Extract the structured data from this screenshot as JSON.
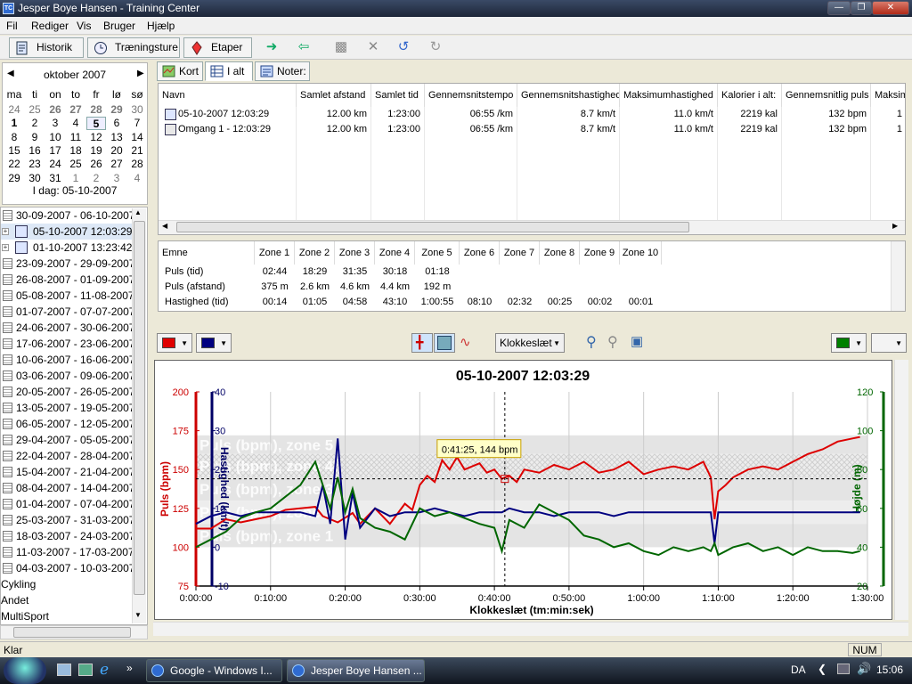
{
  "window": {
    "title": "Jesper Boye Hansen - Training Center",
    "app_icon_text": "TC"
  },
  "menu": [
    "Fil",
    "Rediger",
    "Vis",
    "Bruger",
    "Hjælp"
  ],
  "toolbar": {
    "historik": "Historik",
    "traeningsture": "Træningsture",
    "etaper": "Etaper"
  },
  "calendar": {
    "month": "oktober 2007",
    "weekdays": [
      "ma",
      "ti",
      "on",
      "to",
      "fr",
      "lø",
      "sø"
    ],
    "weeks": [
      [
        "24",
        "25",
        "26",
        "27",
        "28",
        "29",
        "30"
      ],
      [
        "1",
        "2",
        "3",
        "4",
        "5",
        "6",
        "7"
      ],
      [
        "8",
        "9",
        "10",
        "11",
        "12",
        "13",
        "14"
      ],
      [
        "15",
        "16",
        "17",
        "18",
        "19",
        "20",
        "21"
      ],
      [
        "22",
        "23",
        "24",
        "25",
        "26",
        "27",
        "28"
      ],
      [
        "29",
        "30",
        "31",
        "1",
        "2",
        "3",
        "4"
      ]
    ],
    "today": "I dag: 05-10-2007"
  },
  "tree": [
    {
      "label": "30-09-2007 - 06-10-2007",
      "type": "week"
    },
    {
      "label": "05-10-2007 12:03:29",
      "type": "activity",
      "selected": true
    },
    {
      "label": "01-10-2007 13:23:42",
      "type": "activity"
    },
    {
      "label": "23-09-2007 - 29-09-2007",
      "type": "week"
    },
    {
      "label": "26-08-2007 - 01-09-2007",
      "type": "week"
    },
    {
      "label": "05-08-2007 - 11-08-2007",
      "type": "week"
    },
    {
      "label": "01-07-2007 - 07-07-2007",
      "type": "week"
    },
    {
      "label": "24-06-2007 - 30-06-2007",
      "type": "week"
    },
    {
      "label": "17-06-2007 - 23-06-2007",
      "type": "week"
    },
    {
      "label": "10-06-2007 - 16-06-2007",
      "type": "week"
    },
    {
      "label": "03-06-2007 - 09-06-2007",
      "type": "week"
    },
    {
      "label": "20-05-2007 - 26-05-2007",
      "type": "week"
    },
    {
      "label": "13-05-2007 - 19-05-2007",
      "type": "week"
    },
    {
      "label": "06-05-2007 - 12-05-2007",
      "type": "week"
    },
    {
      "label": "29-04-2007 - 05-05-2007",
      "type": "week"
    },
    {
      "label": "22-04-2007 - 28-04-2007",
      "type": "week"
    },
    {
      "label": "15-04-2007 - 21-04-2007",
      "type": "week"
    },
    {
      "label": "08-04-2007 - 14-04-2007",
      "type": "week"
    },
    {
      "label": "01-04-2007 - 07-04-2007",
      "type": "week"
    },
    {
      "label": "25-03-2007 - 31-03-2007",
      "type": "week"
    },
    {
      "label": "18-03-2007 - 24-03-2007",
      "type": "week"
    },
    {
      "label": "11-03-2007 - 17-03-2007",
      "type": "week"
    },
    {
      "label": "04-03-2007 - 10-03-2007",
      "type": "week"
    },
    {
      "label": "Cykling",
      "type": "category"
    },
    {
      "label": "Andet",
      "type": "category"
    },
    {
      "label": "MultiSport",
      "type": "category"
    }
  ],
  "tabs": [
    "Kort",
    "I alt",
    "Noter:"
  ],
  "summary": {
    "columns": [
      "Navn",
      "Samlet afstand",
      "Samlet tid",
      "Gennemsnitstempo",
      "Gennemsnitshastighed",
      "Maksimumhastighed",
      "Kalorier i alt:",
      "Gennemsnitlig puls",
      "Maksim"
    ],
    "rows": [
      [
        "05-10-2007 12:03:29",
        "12.00 km",
        "1:23:00",
        "06:55 /km",
        "8.7 km/t",
        "11.0 km/t",
        "2219 kal",
        "132 bpm",
        "1"
      ],
      [
        "Omgang 1 - 12:03:29",
        "12.00 km",
        "1:23:00",
        "06:55 /km",
        "8.7 km/t",
        "11.0 km/t",
        "2219 kal",
        "132 bpm",
        "1"
      ]
    ]
  },
  "zones": {
    "columns": [
      "Emne",
      "Zone 1",
      "Zone 2",
      "Zone 3",
      "Zone 4",
      "Zone 5",
      "Zone 6",
      "Zone 7",
      "Zone 8",
      "Zone 9",
      "Zone 10"
    ],
    "rows": [
      [
        "Puls (tid)",
        "02:44",
        "18:29",
        "31:35",
        "30:18",
        "01:18",
        "",
        "",
        "",
        "",
        ""
      ],
      [
        "Puls (afstand)",
        "375 m",
        "2.6 km",
        "4.6 km",
        "4.4 km",
        "192 m",
        "",
        "",
        "",
        "",
        ""
      ],
      [
        "Hastighed (tid)",
        "00:14",
        "01:05",
        "04:58",
        "43:10",
        "1:00:55",
        "08:10",
        "02:32",
        "00:25",
        "00:02",
        "00:01"
      ]
    ]
  },
  "graph_toolbar": {
    "time_mode": "Klokkeslæt",
    "color_left1": "#e00000",
    "color_left2": "#000080",
    "color_right": "#008000"
  },
  "chart_data": {
    "type": "line",
    "title": "05-10-2007 12:03:29",
    "xlabel": "Klokkeslæt (tm:min:sek)",
    "x_ticks": [
      "0:00:00",
      "0:10:00",
      "0:20:00",
      "0:30:00",
      "0:40:00",
      "0:50:00",
      "1:00:00",
      "1:10:00",
      "1:20:00",
      "1:30:00"
    ],
    "xlim": [
      0,
      90
    ],
    "axes": [
      {
        "label": "Puls (bpm)",
        "color": "#cc0000",
        "ticks": [
          "75",
          "100",
          "125",
          "150",
          "175",
          "200"
        ],
        "lim": [
          75,
          200
        ]
      },
      {
        "label": "Hastighed (km/t)",
        "color": "#000066",
        "ticks": [
          "-10",
          "0",
          "10",
          "20",
          "30",
          "40"
        ],
        "lim": [
          -10,
          40
        ]
      },
      {
        "label": "Højde (m)",
        "color": "#006600",
        "ticks": [
          "20",
          "40",
          "60",
          "80",
          "100",
          "120"
        ],
        "lim": [
          20,
          120
        ]
      }
    ],
    "zone_labels": [
      "Puls (bpm), zone 5",
      "Puls (bpm), zone 4",
      "Puls (bpm), zone 3",
      "Puls (bpm), zone 2",
      "Puls (bpm), zone 1"
    ],
    "zone_bands_bpm": [
      [
        160,
        172
      ],
      [
        145,
        160
      ],
      [
        130,
        145
      ],
      [
        115,
        130
      ],
      [
        100,
        115
      ]
    ],
    "tooltip": "0:41:25, 144 bpm",
    "cursor": {
      "x": 41.4,
      "bpm": 144
    },
    "series": [
      {
        "name": "Puls (bpm)",
        "axis": 0,
        "color": "#dd0000",
        "x": [
          0,
          2,
          4,
          6,
          8,
          10,
          12,
          14,
          16,
          17,
          18,
          19,
          20,
          21,
          22,
          24,
          26,
          28,
          29,
          30,
          31,
          32,
          33,
          34,
          35,
          36,
          37,
          38,
          39,
          40,
          41,
          42,
          43,
          44,
          46,
          48,
          50,
          52,
          54,
          56,
          58,
          60,
          62,
          64,
          66,
          68,
          69,
          69.5,
          70,
          71,
          72,
          74,
          76,
          78,
          80,
          82,
          84,
          86,
          88,
          89
        ],
        "y": [
          112,
          112,
          118,
          116,
          118,
          120,
          124,
          125,
          126,
          120,
          118,
          116,
          119,
          122,
          115,
          125,
          115,
          128,
          124,
          140,
          146,
          142,
          156,
          150,
          158,
          150,
          152,
          154,
          148,
          150,
          144,
          146,
          142,
          150,
          148,
          153,
          150,
          155,
          148,
          150,
          155,
          147,
          150,
          152,
          150,
          155,
          145,
          118,
          136,
          140,
          145,
          150,
          152,
          150,
          155,
          160,
          163,
          168,
          170,
          171
        ]
      },
      {
        "name": "Hastighed (km/t)",
        "axis": 1,
        "color": "#000080",
        "x": [
          0,
          2,
          4,
          6,
          8,
          10,
          12,
          14,
          16,
          17,
          18,
          19,
          20,
          21,
          22,
          24,
          26,
          28,
          30,
          32,
          34,
          36,
          38,
          40,
          41,
          42,
          44,
          46,
          48,
          50,
          52,
          54,
          56,
          58,
          60,
          62,
          64,
          66,
          68,
          69,
          69.5,
          70,
          71,
          72,
          74,
          76,
          78,
          80,
          82,
          84,
          86,
          88,
          89
        ],
        "y": [
          6,
          8,
          9,
          8,
          9,
          9,
          9,
          9,
          8,
          16,
          6,
          28,
          2,
          14,
          5,
          10,
          8,
          9,
          9,
          10,
          9,
          8,
          9,
          9,
          9,
          10,
          9,
          9,
          8,
          9,
          9,
          9,
          8,
          9,
          9,
          9,
          9,
          9,
          9,
          9,
          1,
          9,
          9,
          9,
          9,
          9,
          9,
          9,
          9,
          9,
          9,
          9,
          9
        ]
      },
      {
        "name": "Højde (m)",
        "axis": 2,
        "color": "#006600",
        "x": [
          0,
          2,
          4,
          6,
          8,
          10,
          12,
          14,
          16,
          17,
          18,
          19,
          20,
          21,
          22,
          24,
          26,
          28,
          30,
          32,
          34,
          36,
          38,
          40,
          41,
          42,
          44,
          46,
          48,
          50,
          52,
          54,
          56,
          58,
          60,
          62,
          64,
          66,
          68,
          69,
          69.5,
          70,
          71,
          72,
          74,
          76,
          78,
          80,
          82,
          84,
          86,
          88,
          89
        ],
        "y": [
          40,
          44,
          48,
          55,
          58,
          60,
          66,
          72,
          84,
          72,
          60,
          76,
          58,
          70,
          55,
          50,
          48,
          44,
          60,
          56,
          58,
          55,
          52,
          50,
          38,
          54,
          50,
          62,
          58,
          54,
          46,
          44,
          40,
          42,
          38,
          36,
          40,
          38,
          40,
          38,
          42,
          36,
          38,
          40,
          42,
          38,
          40,
          36,
          40,
          38,
          38,
          37,
          38
        ]
      }
    ]
  },
  "status": {
    "left": "Klar",
    "num": "NUM"
  },
  "taskbar": {
    "task1": "Google - Windows I...",
    "task2": "Jesper Boye Hansen ...",
    "lang": "DA",
    "clock": "15:06"
  }
}
